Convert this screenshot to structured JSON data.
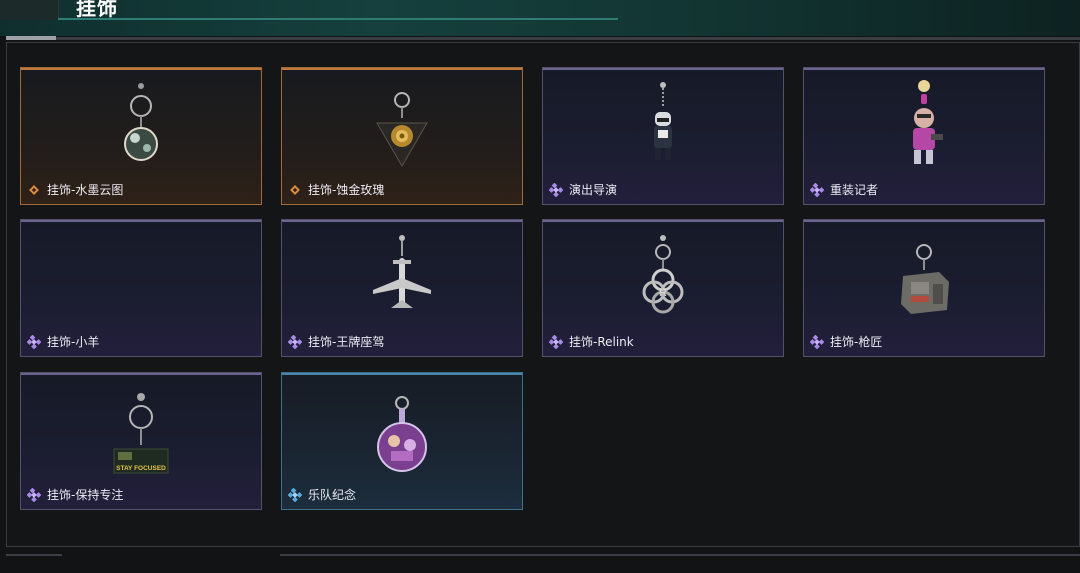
{
  "header": {
    "title": "挂饰"
  },
  "colors": {
    "gold": "#c07a3e",
    "purple": "#9a7be0",
    "blue": "#4a9ed6"
  },
  "items": [
    {
      "label": "挂饰-水墨云图",
      "rarity": "gold",
      "icon": "ink-cloud-orb-charm-icon"
    },
    {
      "label": "挂饰-蚀金玫瑰",
      "rarity": "gold",
      "icon": "gold-rose-charm-icon"
    },
    {
      "label": "演出导演",
      "rarity": "purple",
      "icon": "director-figure-charm-icon"
    },
    {
      "label": "重装记者",
      "rarity": "purple",
      "icon": "reporter-figure-charm-icon"
    },
    {
      "label": "挂饰-小羊",
      "rarity": "purple",
      "icon": "lamb-charm-icon"
    },
    {
      "label": "挂饰-王牌座驾",
      "rarity": "purple",
      "icon": "airplane-charm-icon"
    },
    {
      "label": "挂饰-Relink",
      "rarity": "purple",
      "icon": "relink-logo-charm-icon"
    },
    {
      "label": "挂饰-枪匠",
      "rarity": "purple",
      "icon": "gunsmith-box-charm-icon"
    },
    {
      "label": "挂饰-保持专注",
      "rarity": "purple",
      "icon": "stay-focused-charm-icon"
    },
    {
      "label": "乐队纪念",
      "rarity": "blue",
      "icon": "band-badge-charm-icon"
    }
  ],
  "stay_focused_text": "STAY FOCUSED"
}
